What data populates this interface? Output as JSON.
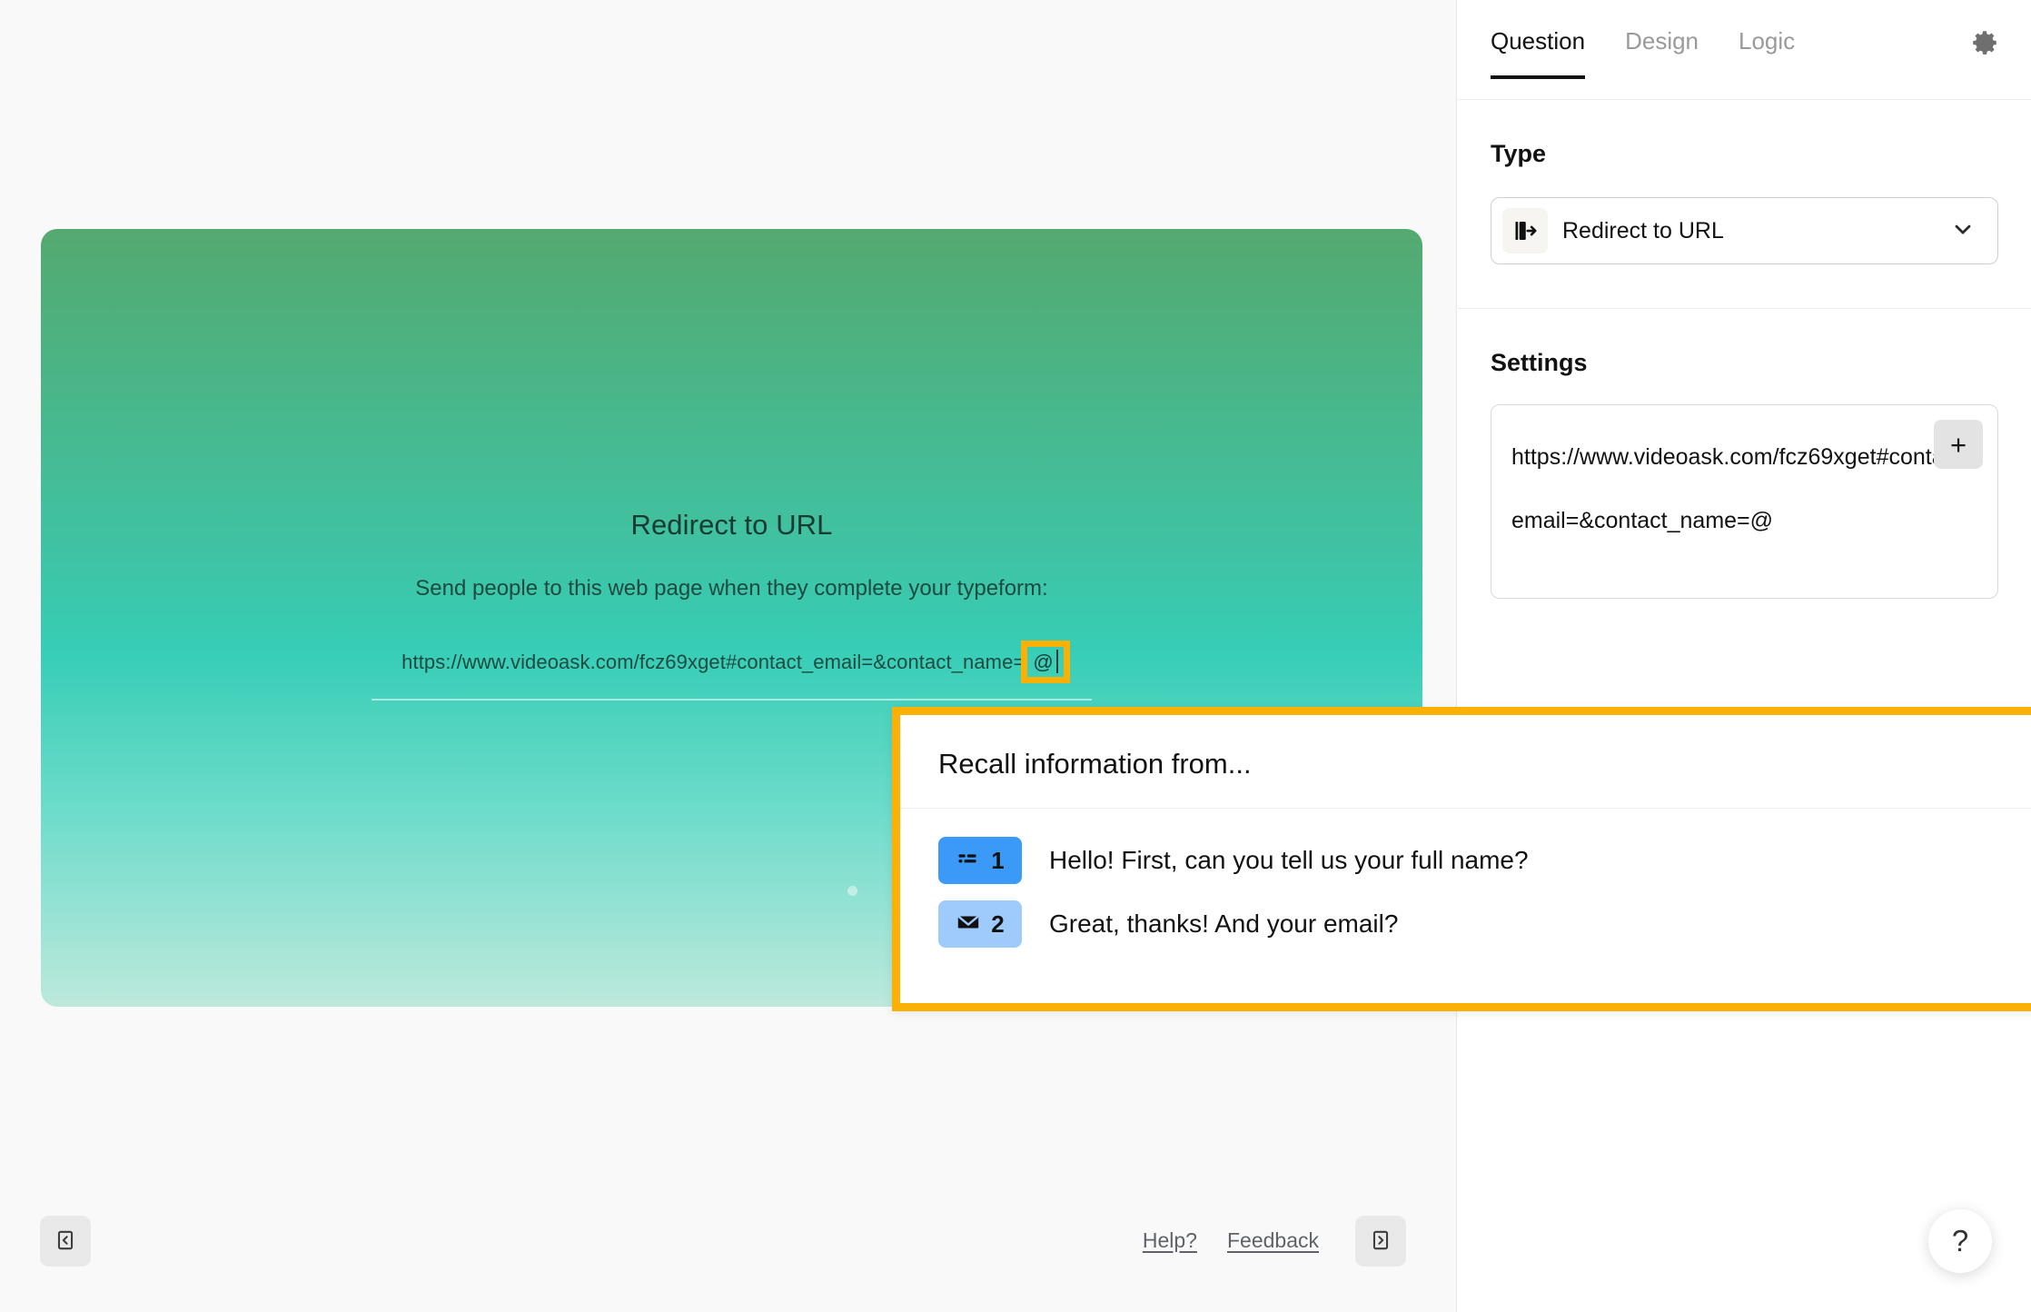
{
  "panel": {
    "tabs": [
      {
        "label": "Question",
        "active": true
      },
      {
        "label": "Design",
        "active": false
      },
      {
        "label": "Logic",
        "active": false
      }
    ],
    "gear_icon": "gear-icon",
    "type": {
      "heading": "Type",
      "selected_label": "Redirect to URL",
      "icon": "redirect-exit-icon",
      "chevron": "chevron-down-icon"
    },
    "settings": {
      "heading": "Settings",
      "url_value": "https://www.videoask.com/fcz69xget#contact_email=&contact_name=@",
      "add_button_label": "+",
      "add_button_icon": "plus-icon"
    }
  },
  "canvas": {
    "card": {
      "title": "Redirect to URL",
      "subtitle": "Send people to this web page when they complete your typeform:",
      "url_prefix": "https://www.videoask.com/fcz69xget#contact_email=&contact_name=",
      "url_token": "@"
    },
    "bottom_bar": {
      "collapse_left_icon": "panel-collapse-left-icon",
      "collapse_right_icon": "panel-collapse-right-icon",
      "links": [
        {
          "label": "Help?"
        },
        {
          "label": "Feedback"
        }
      ]
    },
    "help_fab": {
      "label": "?",
      "icon": "question-mark-icon"
    }
  },
  "recall_popup": {
    "title": "Recall information from...",
    "items": [
      {
        "number": "1",
        "icon": "short-text-icon",
        "badge_color": "#3B9AF8",
        "label": "Hello! First, can you tell us your full name?"
      },
      {
        "number": "2",
        "icon": "email-envelope-icon",
        "badge_color": "#9ECBFC",
        "label": "Great, thanks! And your email?"
      }
    ]
  },
  "colors": {
    "highlight_orange": "#FAB005",
    "card_gradient_top": "#54A96F",
    "card_gradient_mid": "#36CDB6",
    "card_gradient_bottom": "#BDE9DC",
    "accent_dark": "#121212"
  }
}
